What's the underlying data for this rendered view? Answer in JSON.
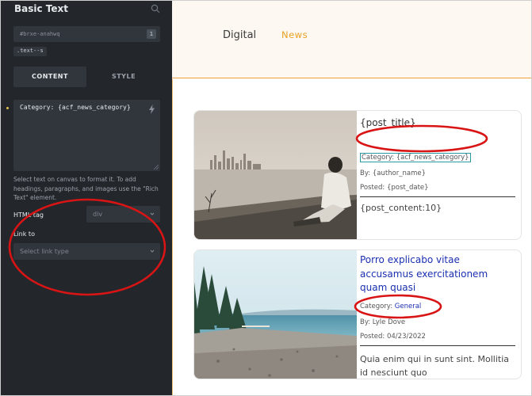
{
  "panel": {
    "title": "Basic Text",
    "element_id": "#brxe-anahwq",
    "id_badge": "1",
    "class_chip": ".text--s",
    "tabs": [
      {
        "label": "CONTENT"
      },
      {
        "label": "STYLE"
      }
    ],
    "text_value": "Category: {acf_news_category}",
    "help_text": "Select text on canvas to format it. To add headings, paragraphs, and images use the \"Rich Text\" element.",
    "html_tag": {
      "label": "HTML tag",
      "value": "div"
    },
    "link_to": {
      "label": "Link to",
      "placeholder": "Select link type"
    }
  },
  "site": {
    "nav": [
      {
        "label": "Digital"
      },
      {
        "label": "News"
      }
    ]
  },
  "cards": [
    {
      "title": "{post_title}",
      "category": "Category: {acf_news_category}",
      "author": "By: {author_name}",
      "date": "Posted: {post_date}",
      "excerpt": "{post_content:10}"
    },
    {
      "title": "Porro explicabo vitae accusamus exercitationem quam quasi",
      "category_label": "Category: ",
      "category_value": "General",
      "author": "By: Lyle Dove",
      "date": "Posted: 04/23/2022",
      "excerpt": "Quia enim qui in sunt sint. Mollitia id nesciunt quo"
    }
  ],
  "colors": {
    "panel_bg": "#23272c",
    "field_bg": "#31363c",
    "accent_orange": "#e8a020",
    "link_blue": "#1a2fb0",
    "annotation_red": "#d81414",
    "selection_teal": "#2b9ba0"
  }
}
